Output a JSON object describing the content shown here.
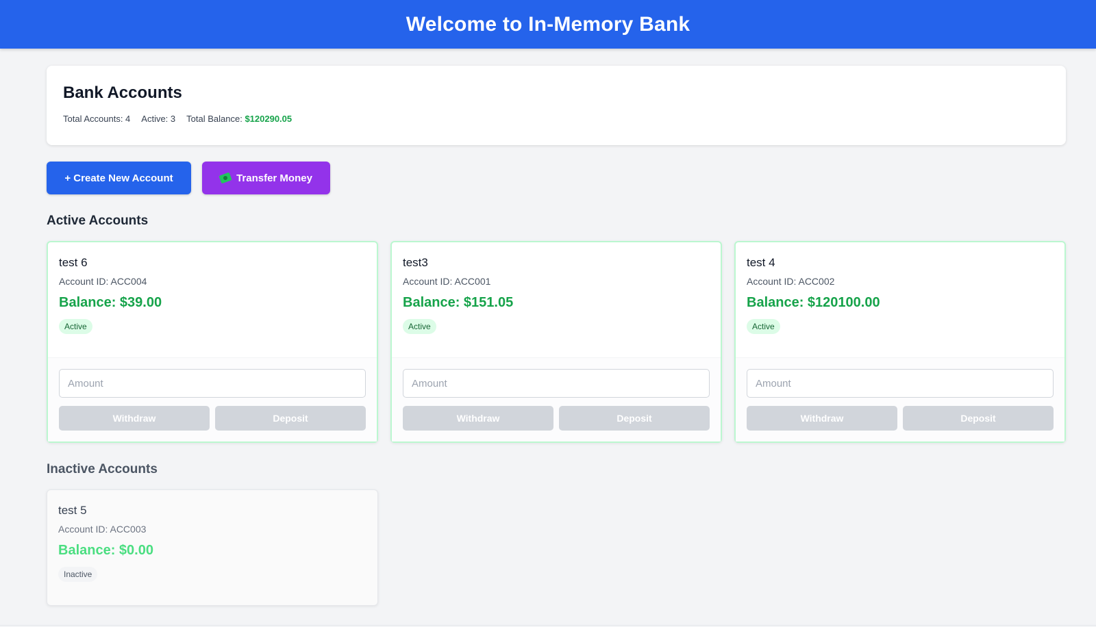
{
  "header": {
    "title": "Welcome to In-Memory Bank"
  },
  "summary": {
    "title": "Bank Accounts",
    "total_accounts": "Total Accounts: 4",
    "active": "Active: 3",
    "total_balance_label": "Total Balance:",
    "total_balance_value": "$120290.05"
  },
  "toolbar": {
    "create_label": "+ Create New Account",
    "transfer_label": "Transfer Money",
    "transfer_icon": "money-icon"
  },
  "active_section": {
    "title": "Active Accounts",
    "accounts": [
      {
        "name": "test 6",
        "id": "Account ID: ACC004",
        "balance": "Balance: $39.00",
        "status": "Active",
        "placeholder": "Amount",
        "withdraw": "Withdraw",
        "deposit": "Deposit"
      },
      {
        "name": "test3",
        "id": "Account ID: ACC001",
        "balance": "Balance: $151.05",
        "status": "Active",
        "placeholder": "Amount",
        "withdraw": "Withdraw",
        "deposit": "Deposit"
      },
      {
        "name": "test 4",
        "id": "Account ID: ACC002",
        "balance": "Balance: $120100.00",
        "status": "Active",
        "placeholder": "Amount",
        "withdraw": "Withdraw",
        "deposit": "Deposit"
      }
    ]
  },
  "inactive_section": {
    "title": "Inactive Accounts",
    "accounts": [
      {
        "name": "test 5",
        "id": "Account ID: ACC003",
        "balance": "Balance: $0.00",
        "status": "Inactive"
      }
    ]
  },
  "colors": {
    "header_bg": "#2563eb",
    "primary_button": "#2563eb",
    "transfer_button": "#9333ea",
    "balance_green": "#16a34a"
  }
}
